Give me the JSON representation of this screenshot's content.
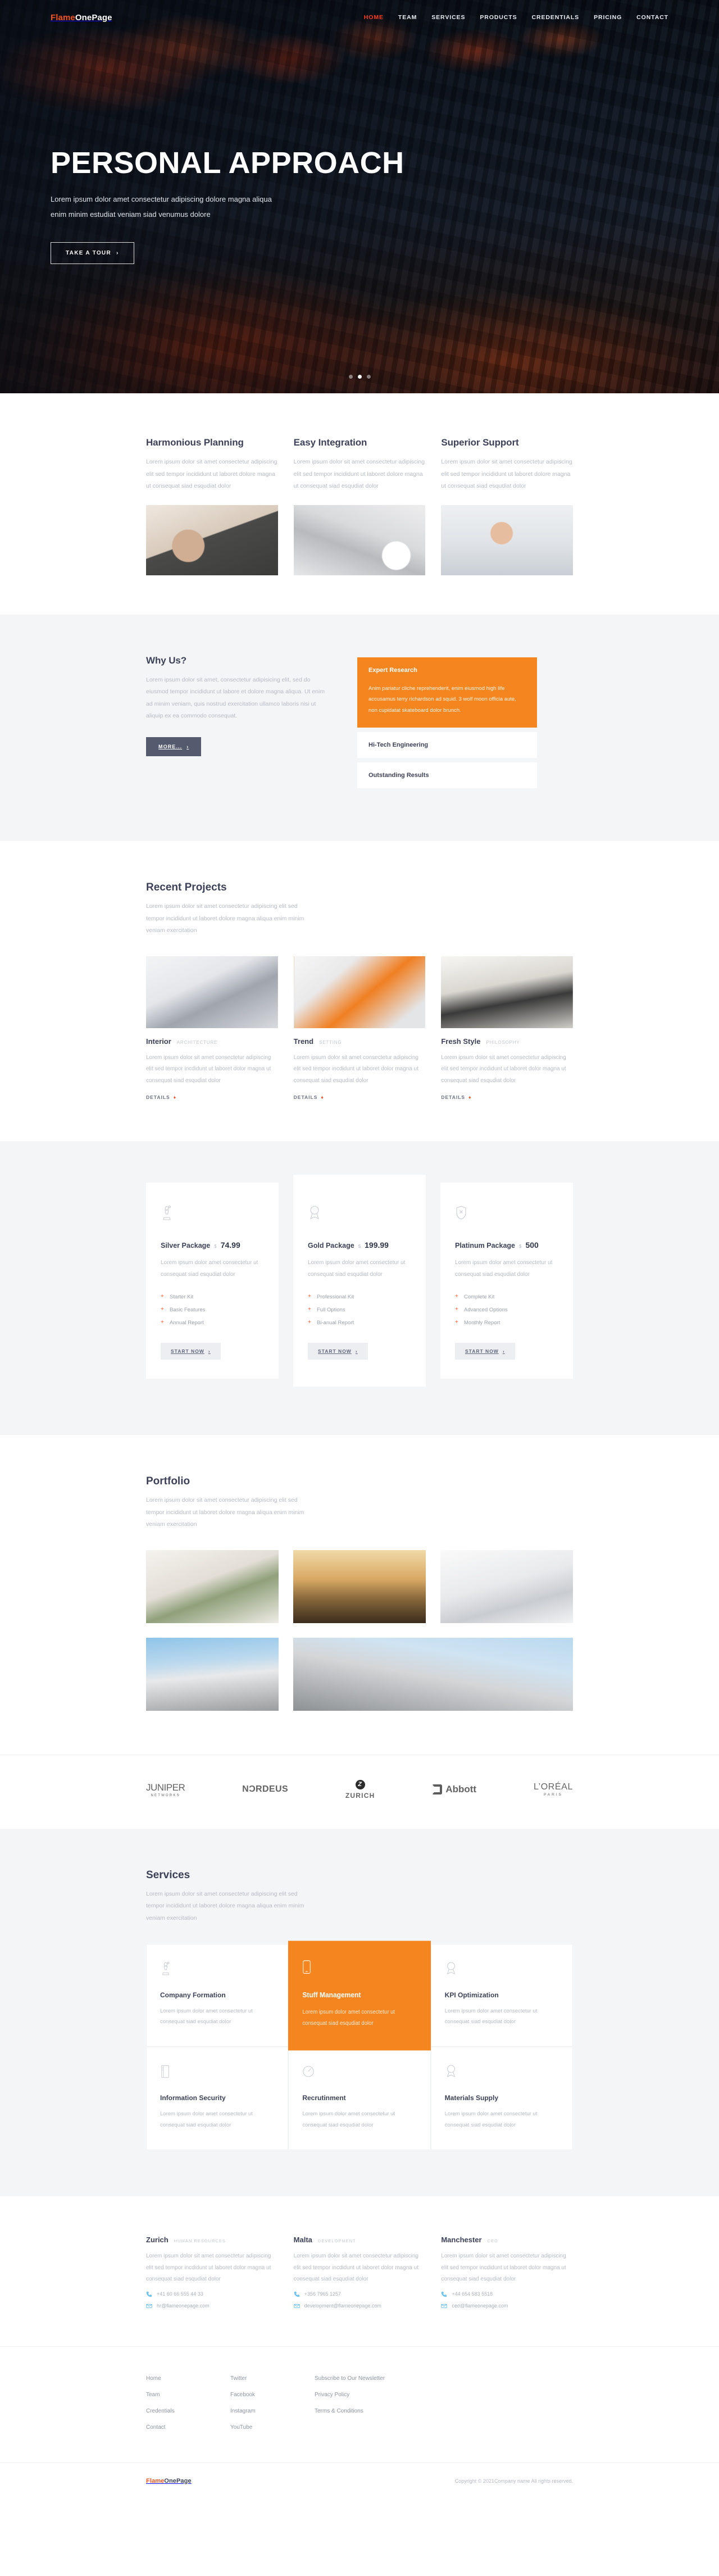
{
  "brand": {
    "part1": "Flame",
    "part2": "OnePage"
  },
  "nav": {
    "items": [
      {
        "label": "HOME",
        "active": true
      },
      {
        "label": "TEAM",
        "active": false
      },
      {
        "label": "SERVICES",
        "active": false
      },
      {
        "label": "PRODUCTS",
        "active": false
      },
      {
        "label": "CREDENTIALS",
        "active": false
      },
      {
        "label": "PRICING",
        "active": false
      },
      {
        "label": "CONTACT",
        "active": false
      }
    ]
  },
  "hero": {
    "title": "PERSONAL APPROACH",
    "subtitle": "Lorem ipsum dolor amet consectetur adipiscing dolore magna aliqua enim minim estudiat veniam siad venumus dolore",
    "cta": "TAKE A TOUR",
    "cta_caret": "›",
    "slides": 3,
    "active_slide": 2
  },
  "features": {
    "items": [
      {
        "title": "Harmonious Planning",
        "text": "Lorem ipsum dolor sit amet consectetur adipiscing elit sed tempor incididunt ut laboret dolore magna ut consequat siad esqudiat dolor"
      },
      {
        "title": "Easy Integration",
        "text": "Lorem ipsum dolor sit amet consectetur adipiscing elit sed tempor incididunt ut laboret dolore magna ut consequat siad esqudiat dolor"
      },
      {
        "title": "Superior Support",
        "text": "Lorem ipsum dolor sit amet consectetur adipiscing elit sed tempor incididunt ut laboret dolore magna ut consequat siad esqudiat dolor"
      }
    ]
  },
  "whyus": {
    "title": "Why Us?",
    "text": "Lorem ipsum dolor sit amet, consectetur adipisicing elit, sed do eiusmod tempor incididunt ut labore et dolore magna aliqua. Ut enim ad minim veniam, quis nostrud exercitation ullamco laboris nisi ut aliquip ex ea commodo consequat.",
    "button": "MORE...",
    "button_caret": "›",
    "accordion": [
      {
        "title": "Expert Research",
        "open": true,
        "body": "Anim pariatur cliche reprehenderit, enim eiusmod high life accusamus terry richardson ad squid. 3 wolf moon officia aute, non cupidatat skateboard dolor brunch."
      },
      {
        "title": "Hi-Tech Engineering",
        "open": false,
        "body": ""
      },
      {
        "title": "Outstanding Results",
        "open": false,
        "body": ""
      }
    ]
  },
  "projects": {
    "title": "Recent Projects",
    "subtitle": "Lorem ipsum dolor sit amet consectetur adipiscing elit sed tempor incididunt ut laboret dolore magna aliqua enim minim veniam exercitation",
    "details_label": "DETAILS",
    "details_caret": "♦",
    "items": [
      {
        "title": "Interior",
        "category": "ARCHITECTURE",
        "text": "Lorem ipsum dolor sit amet consectetur adipiscing elit sed tempor incdidunt ut laboret dolor magna ut consequat siad esqudiat dolor"
      },
      {
        "title": "Trend",
        "category": "SETTING",
        "text": "Lorem ipsum dolor sit amet consectetur adipiscing elit sed tempor incdidunt ut laboret dolor magna ut consequat siad esqudiat dolor"
      },
      {
        "title": "Fresh Style",
        "category": "PHILOSOPHY",
        "text": "Lorem ipsum dolor sit amet consectetur adipiscing elit sed tempor incdidunt ut laboret dolor magna ut consequat siad esqudiat dolor"
      }
    ]
  },
  "pricing": {
    "currency": "$",
    "button": "START NOW",
    "button_caret": "›",
    "plans": [
      {
        "icon": "chess-pawn-icon",
        "name": "Silver Package",
        "price": "74.99",
        "desc": "Lorem ipsum dolor amet consectetur ut consequat siad esqudiat dolor",
        "features": [
          "Starter Kit",
          "Basic Features",
          "Annual Report"
        ],
        "featured": false
      },
      {
        "icon": "award-ribbon-icon",
        "name": "Gold Package",
        "price": "199.99",
        "desc": "Lorem ipsum dolor amet consectetur ut consequat siad esqudiat dolor",
        "features": [
          "Professional Kit",
          "Full Options",
          "Bi-anual Report"
        ],
        "featured": true
      },
      {
        "icon": "shield-icon",
        "name": "Platinum Package",
        "price": "500",
        "desc": "Lorem ipsum dolor amet consectetur ut consequat siad esqudiat dolor",
        "features": [
          "Complete Kit",
          "Advanced Options",
          "Monthly Report"
        ],
        "featured": false
      }
    ]
  },
  "portfolio": {
    "title": "Portfolio",
    "subtitle": "Lorem ipsum dolor sit amet consectetur adipiscing elit sed tempor incididunt ut laboret dolore magna aliqua enim minim veniam exercitation",
    "items": [
      {
        "name": "succulent-plants-photo"
      },
      {
        "name": "runner-sunset-photo"
      },
      {
        "name": "alarm-clock-bed-photo"
      },
      {
        "name": "patterned-building-photo"
      },
      {
        "name": "modern-architecture-photo"
      }
    ]
  },
  "brands": {
    "items": [
      {
        "name": "JUNIPER",
        "sub": "NETWORKS",
        "kind": "juniper"
      },
      {
        "name": "NƆRDEUS",
        "sub": "",
        "kind": "nordeus"
      },
      {
        "name": "ZURICH",
        "sub": "",
        "kind": "zurich"
      },
      {
        "name": "Abbott",
        "sub": "",
        "kind": "abbott"
      },
      {
        "name": "L’ORÉAL",
        "sub": "PARIS",
        "kind": "loreal"
      }
    ]
  },
  "services": {
    "title": "Services",
    "subtitle": "Lorem ipsum dolor sit amet consectetur adipiscing elit sed tempor incididunt ut laboret dolore magna aliqua enim minim veniam exercitation",
    "items": [
      {
        "icon": "chess-pawn-icon",
        "title": "Company Formation",
        "text": "Lorem ipsum dolor amet consectetur ut consequat siad esqudiat dolor",
        "highlight": false
      },
      {
        "icon": "mobile-phone-icon",
        "title": "Stuff Management",
        "text": "Lorem ipsum dolor amet consectetur ut consequat siad esqudiat dolor",
        "highlight": true
      },
      {
        "icon": "award-ribbon-icon",
        "title": "KPI Optimization",
        "text": "Lorem ipsum dolor amet consectetur ut consequat siad esqudiat dolor",
        "highlight": false
      },
      {
        "icon": "book-icon",
        "title": "Information Security",
        "text": "Lorem ipsum dolor amet consectetur ut consequat siad esqudiat dolor",
        "highlight": false
      },
      {
        "icon": "gauge-icon",
        "title": "Recrutinment",
        "text": "Lorem ipsum dolor amet consectetur ut consequat siad esqudiat dolor",
        "highlight": false
      },
      {
        "icon": "award-ribbon-icon",
        "title": "Materials Supply",
        "text": "Lorem ipsum dolor amet consectetur ut consequat siad esqudiat dolor",
        "highlight": false
      }
    ]
  },
  "contacts": {
    "items": [
      {
        "city": "Zurich",
        "role": "HUMAN RESOURCES",
        "text": "Lorem ipsum dolor sit amet consectetur adipiscing elit sed tempor incdidunt ut laboret dolor magna ut consequat siad esqudiat dolor",
        "phone": "+41 60 66 555 44 33",
        "email": "hr@flameonepage.com"
      },
      {
        "city": "Malta",
        "role": "DEVELOPMENT",
        "text": "Lorem ipsum dolor sit amet consectetur adipiscing elit sed tempor incdidunt ut laboret dolor magna ut consequat siad esqudiat dolor",
        "phone": "+356 7965 1257",
        "email": "development@flameonepage.com"
      },
      {
        "city": "Manchester",
        "role": "CEO",
        "text": "Lorem ipsum dolor sit amet consectetur adipiscing elit sed tempor incdidunt ut laboret dolor magna ut consequat siad esqudiat dolor",
        "phone": "+44 654 583 5518",
        "email": "ceo@flameonepage.com"
      }
    ]
  },
  "footer": {
    "col1": [
      "Home",
      "Team",
      "Credentials",
      "Contact"
    ],
    "col2": [
      "Twitter",
      "Facebook",
      "Instagram",
      "YouTube"
    ],
    "col3": [
      "Subscribe to Our Newsletter",
      "Privacy Policy",
      "Terms & Conditions"
    ],
    "copyright": "Copyright © 2021Company name All rights reserved."
  },
  "colors": {
    "accent_orange": "#f5861f",
    "brand_red": "#f4511e",
    "dark_text": "#3c4157",
    "muted_text": "#b7bbc6",
    "light_bg": "#f4f5f7"
  }
}
